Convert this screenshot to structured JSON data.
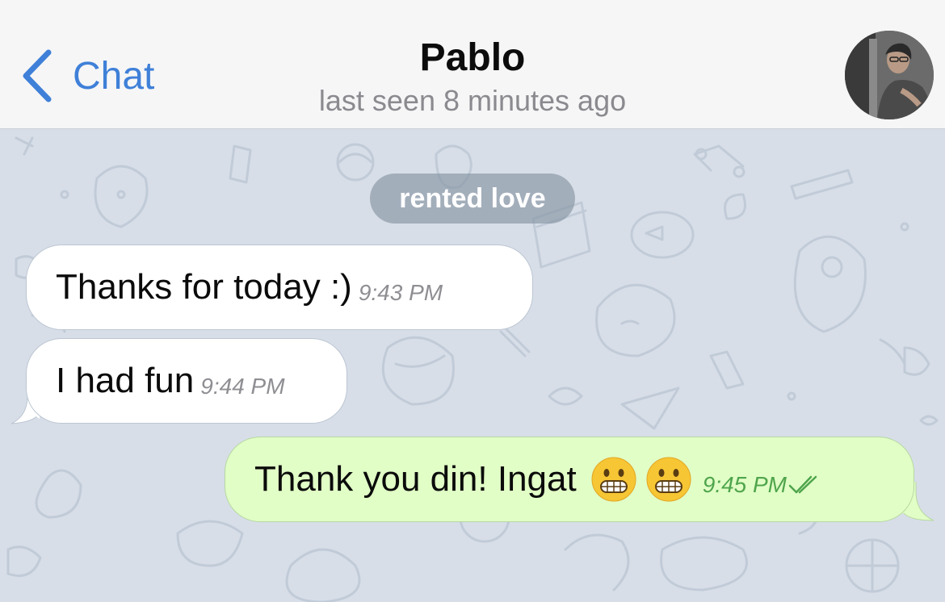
{
  "header": {
    "back_label": "Chat",
    "title": "Pablo",
    "status": "last seen 8 minutes ago"
  },
  "chat": {
    "service_message": "rented love",
    "messages": [
      {
        "direction": "incoming",
        "text": "Thanks for today :)",
        "time": "9:43 PM"
      },
      {
        "direction": "incoming",
        "text": "I had fun",
        "time": "9:44 PM"
      },
      {
        "direction": "outgoing",
        "text": "Thank you din! Ingat",
        "emojis": [
          "grimacing-face",
          "grimacing-face"
        ],
        "time": "9:45 PM",
        "status": "read"
      }
    ]
  },
  "colors": {
    "accent": "#3f80d8",
    "outgoing_bubble": "#e1fec6",
    "incoming_bubble": "#ffffff",
    "wallpaper": "#d7dee8",
    "read_check": "#4fa54c"
  }
}
